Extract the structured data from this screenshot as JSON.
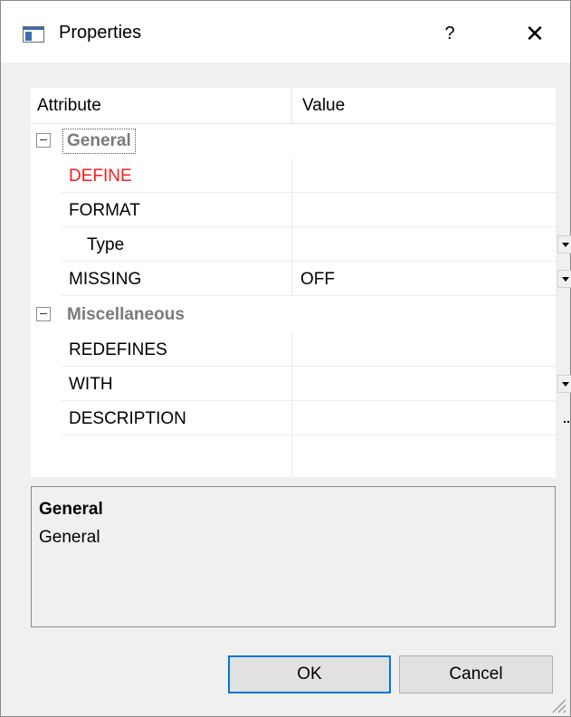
{
  "window": {
    "title": "Properties",
    "help_label": "?",
    "close_label": "✕"
  },
  "grid": {
    "header": {
      "attribute": "Attribute",
      "value": "Value"
    },
    "categories": [
      {
        "label": "General",
        "rows": [
          {
            "name": "DEFINE",
            "value": "",
            "color": "#ff1a1a"
          },
          {
            "name": "FORMAT",
            "value": ""
          },
          {
            "name": "Type",
            "value": "",
            "has_dropdown": true
          },
          {
            "name": "MISSING",
            "value": "OFF",
            "has_dropdown": true
          }
        ]
      },
      {
        "label": "Miscellaneous",
        "rows": [
          {
            "name": "REDEFINES",
            "value": ""
          },
          {
            "name": "WITH",
            "value": "",
            "has_dropdown": true
          },
          {
            "name": "DESCRIPTION",
            "value": "",
            "has_ellipsis": true,
            "ellipsis_label": "..."
          }
        ]
      }
    ]
  },
  "description": {
    "title": "General",
    "text": "General"
  },
  "buttons": {
    "ok": "OK",
    "cancel": "Cancel"
  }
}
